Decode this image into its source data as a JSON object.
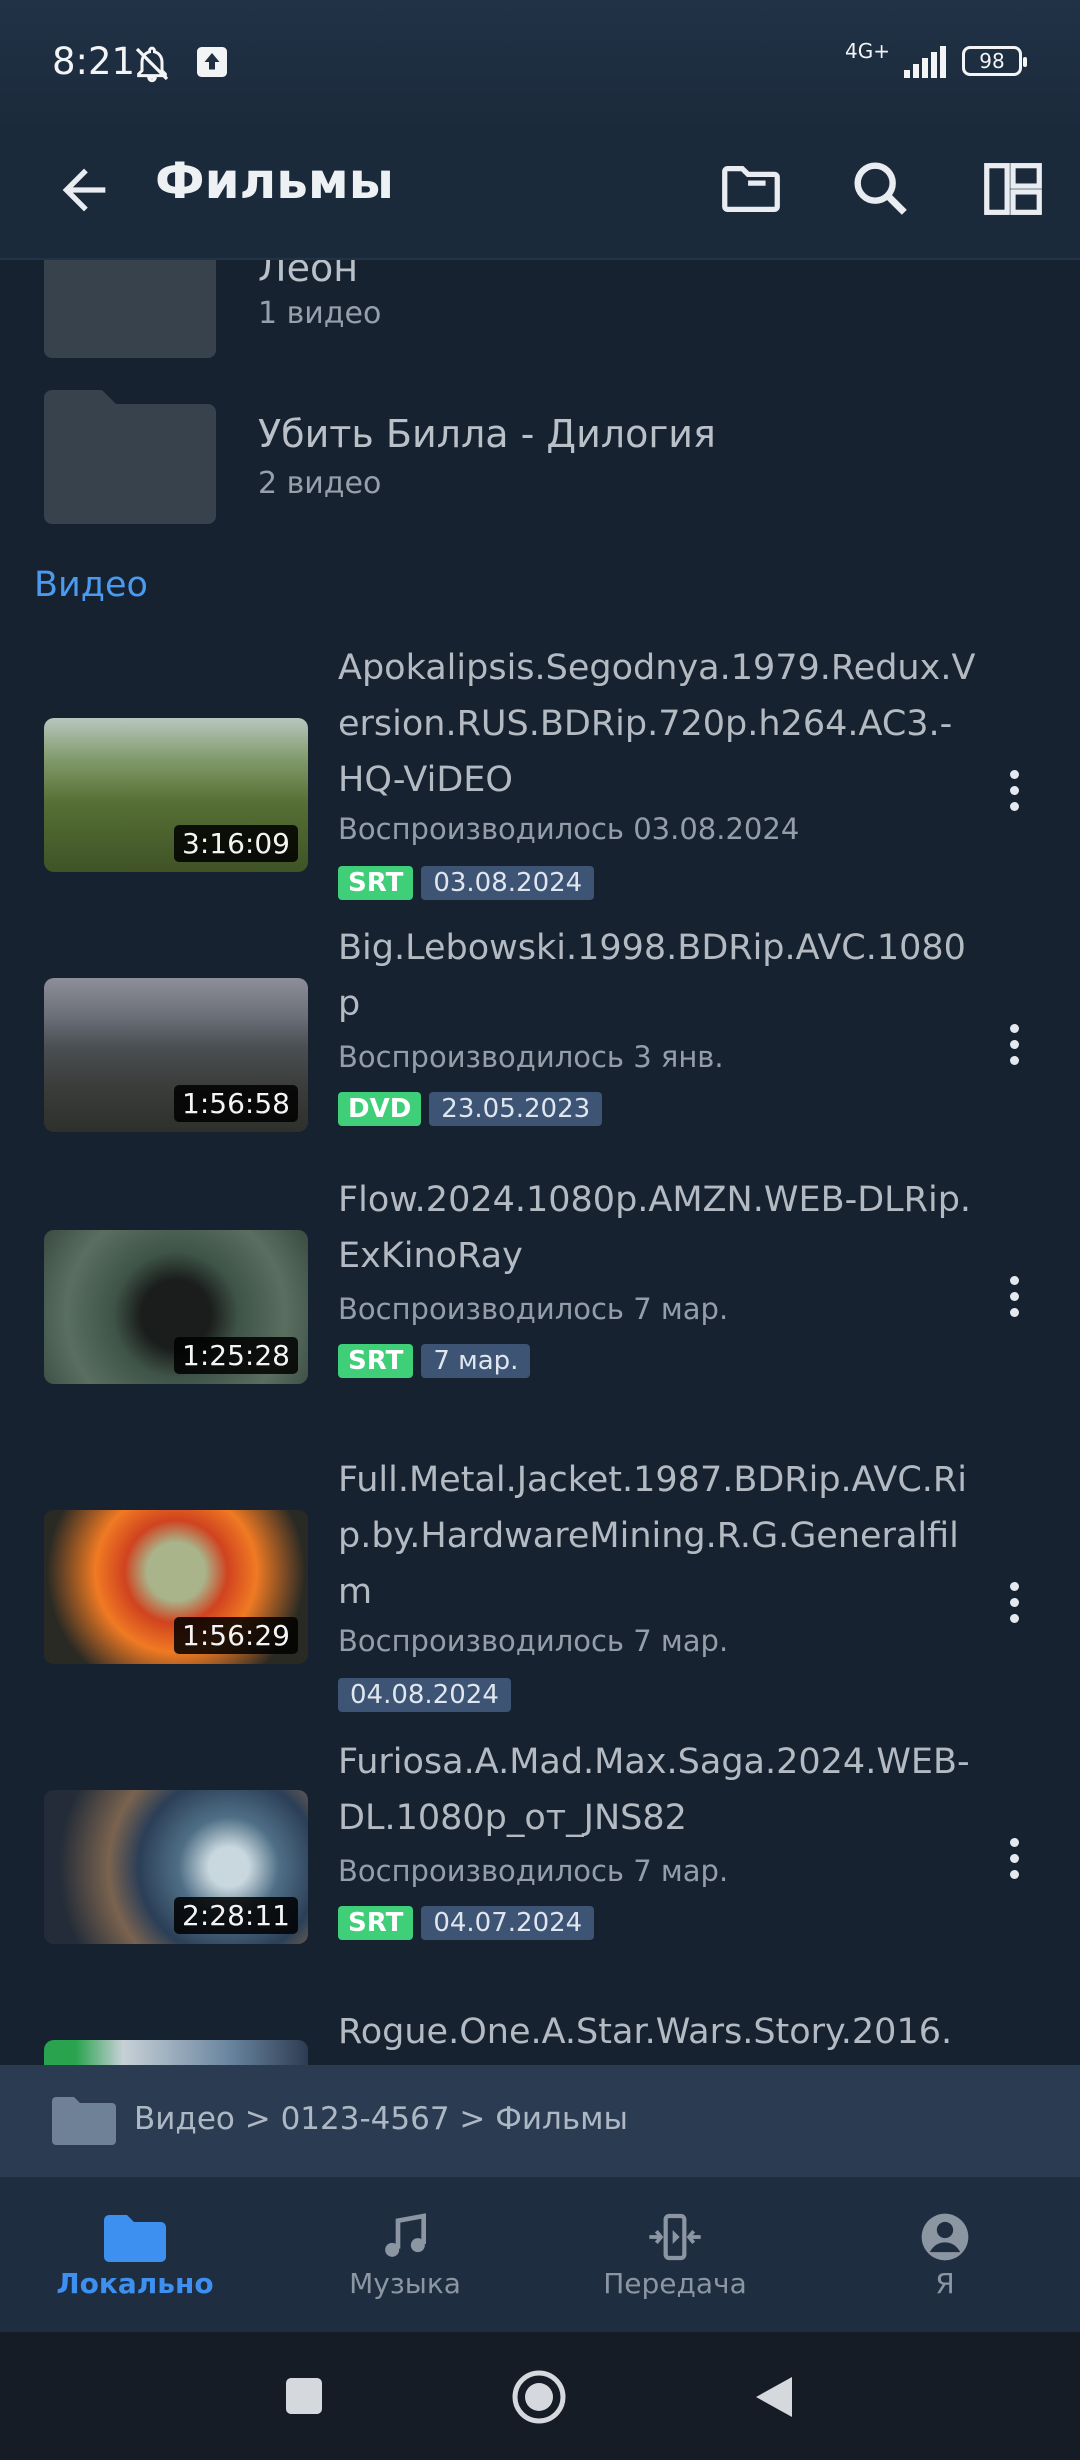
{
  "status": {
    "time": "8:21",
    "network": "4G+",
    "battery": "98"
  },
  "appbar": {
    "title": "Фильмы"
  },
  "folders": [
    {
      "name": "Леон",
      "count": "1 видео"
    },
    {
      "name": "Убить Билла - Дилогия",
      "count": "2 видео"
    }
  ],
  "section_label": "Видео",
  "videos": [
    {
      "title": "Apokalipsis.Segodnya.1979.Redux.Version.RUS.BDRip.720p.h264.AC3.-HQ-ViDEO",
      "duration": "3:16:09",
      "played": "Воспроизводилось 03.08.2024",
      "subtitle_tag": "SRT",
      "date": "03.08.2024"
    },
    {
      "title": "Big.Lebowski.1998.BDRip.AVC.1080p",
      "duration": "1:56:58",
      "played": "Воспроизводилось 3 янв.",
      "subtitle_tag": "DVD",
      "date": "23.05.2023"
    },
    {
      "title": "Flow.2024.1080p.AMZN.WEB-DLRip.ExKinoRay",
      "duration": "1:25:28",
      "played": "Воспроизводилось 7 мар.",
      "subtitle_tag": "SRT",
      "date": "7 мар."
    },
    {
      "title": "Full.Metal.Jacket.1987.BDRip.AVC.Rip.by.HardwareMining.R.G.Generalfilm",
      "duration": "1:56:29",
      "played": "Воспроизводилось 7 мар.",
      "subtitle_tag": "",
      "date": "04.08.2024"
    },
    {
      "title": "Furiosa.A.Mad.Max.Saga.2024.WEB-DL.1080p_от_JNS82",
      "duration": "2:28:11",
      "played": "Воспроизводилось 7 мар.",
      "subtitle_tag": "SRT",
      "date": "04.07.2024"
    },
    {
      "title": "Rogue.One.A.Star.Wars.Story.2016."
    }
  ],
  "path": "Видео > 0123-4567 > Фильмы",
  "bottom_nav": [
    {
      "label": "Локально",
      "icon": "folder-icon",
      "active": true
    },
    {
      "label": "Музыка",
      "icon": "music-note-icon",
      "active": false
    },
    {
      "label": "Передача",
      "icon": "transfer-icon",
      "active": false
    },
    {
      "label": "Я",
      "icon": "account-icon",
      "active": false
    }
  ],
  "colors": {
    "background": "#172230",
    "accent": "#3d8ff0",
    "subtitle_tag": "#3ecf78",
    "date_tag": "#3d5475"
  }
}
